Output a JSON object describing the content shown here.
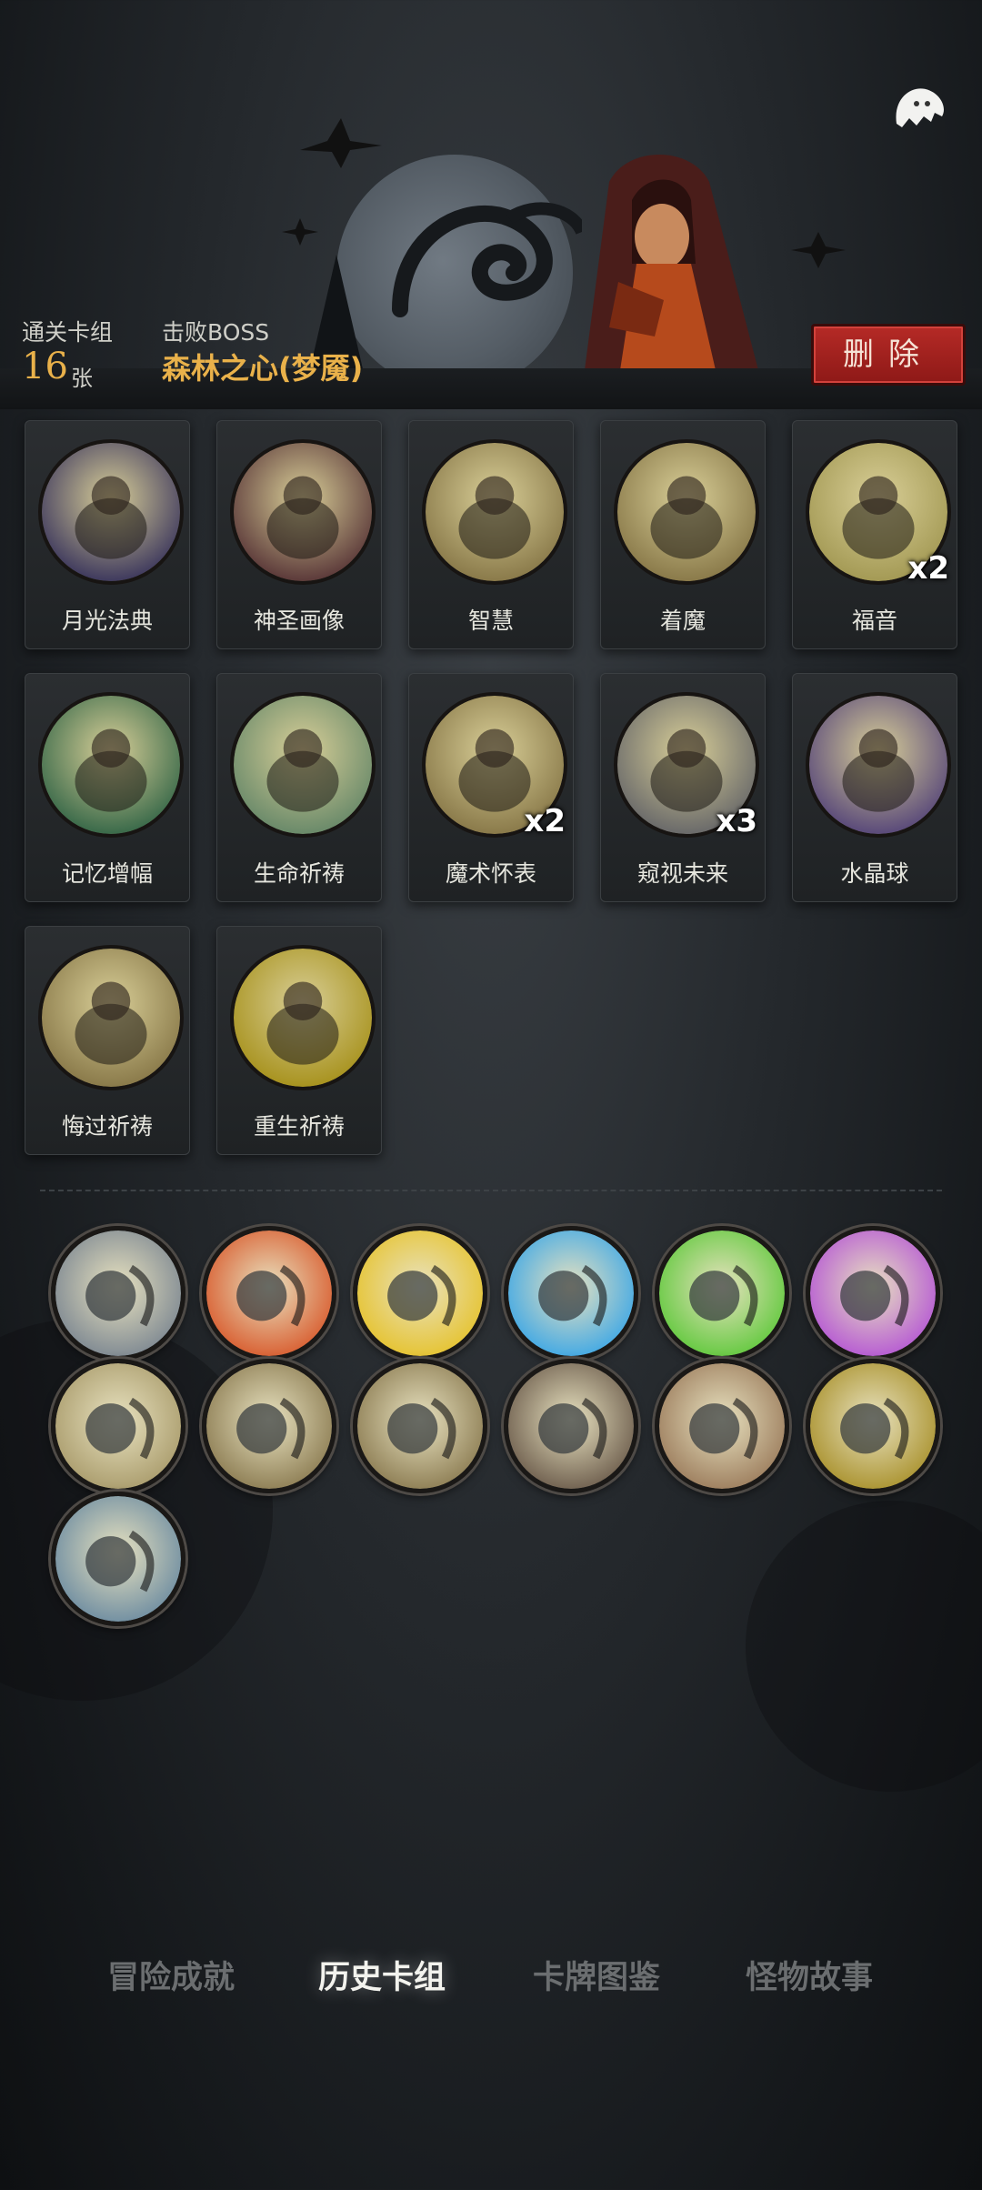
{
  "header": {
    "deck_label": "通关卡组",
    "deck_count": "16",
    "deck_unit": "张",
    "boss_label": "击败BOSS",
    "boss_name": "森林之心(梦魇)",
    "delete_label": "删除"
  },
  "cards": [
    {
      "name": "月光法典",
      "mult": "",
      "icon": "moonlight-codex-icon",
      "color": "#3f3a5e"
    },
    {
      "name": "神圣画像",
      "mult": "",
      "icon": "holy-portrait-icon",
      "color": "#5c3a3a"
    },
    {
      "name": "智慧",
      "mult": "",
      "icon": "wisdom-icon",
      "color": "#8a7a4a"
    },
    {
      "name": "着魔",
      "mult": "",
      "icon": "possessed-icon",
      "color": "#8a7a4a"
    },
    {
      "name": "福音",
      "mult": "x2",
      "icon": "gospel-icon",
      "color": "#a49a55"
    },
    {
      "name": "记忆增幅",
      "mult": "",
      "icon": "memory-boost-icon",
      "color": "#3a6a4a"
    },
    {
      "name": "生命祈祷",
      "mult": "",
      "icon": "life-prayer-icon",
      "color": "#6a8a6a"
    },
    {
      "name": "魔术怀表",
      "mult": "x2",
      "icon": "magic-pocket-watch-icon",
      "color": "#8a7a4a"
    },
    {
      "name": "窥视未来",
      "mult": "x3",
      "icon": "peek-future-icon",
      "color": "#6a6a6a"
    },
    {
      "name": "水晶球",
      "mult": "",
      "icon": "crystal-ball-icon",
      "color": "#5a4a7a"
    },
    {
      "name": "悔过祈祷",
      "mult": "",
      "icon": "repentance-prayer-icon",
      "color": "#8a7a4a"
    },
    {
      "name": "重生祈祷",
      "mult": "",
      "icon": "rebirth-prayer-icon",
      "color": "#a8931f"
    }
  ],
  "relics": [
    {
      "icon": "moon-hood-relic-icon",
      "color": "#7a8590"
    },
    {
      "icon": "skull-red-flame-icon",
      "color": "#d8582a"
    },
    {
      "icon": "skull-yellow-flame-icon",
      "color": "#e6c22a"
    },
    {
      "icon": "skull-blue-flame-icon",
      "color": "#3aa6e6"
    },
    {
      "icon": "skull-green-flame-icon",
      "color": "#5ec83a"
    },
    {
      "icon": "skull-purple-flame-icon",
      "color": "#b454d4"
    },
    {
      "icon": "twin-girls-relic-icon",
      "color": "#a89a6a"
    },
    {
      "icon": "blade-relic-icon",
      "color": "#8a7a50"
    },
    {
      "icon": "priest-relic-icon",
      "color": "#8a7a50"
    },
    {
      "icon": "dagger-book-relic-icon",
      "color": "#6a5a4a"
    },
    {
      "icon": "brute-relic-icon",
      "color": "#9a7a5a"
    },
    {
      "icon": "red-demon-relic-icon",
      "color": "#a8902a"
    },
    {
      "icon": "knife-relic-icon",
      "color": "#6a8aa0"
    }
  ],
  "nav": {
    "tab1": "冒险成就",
    "tab2": "历史卡组",
    "tab3": "卡牌图鉴",
    "tab4": "怪物故事"
  }
}
